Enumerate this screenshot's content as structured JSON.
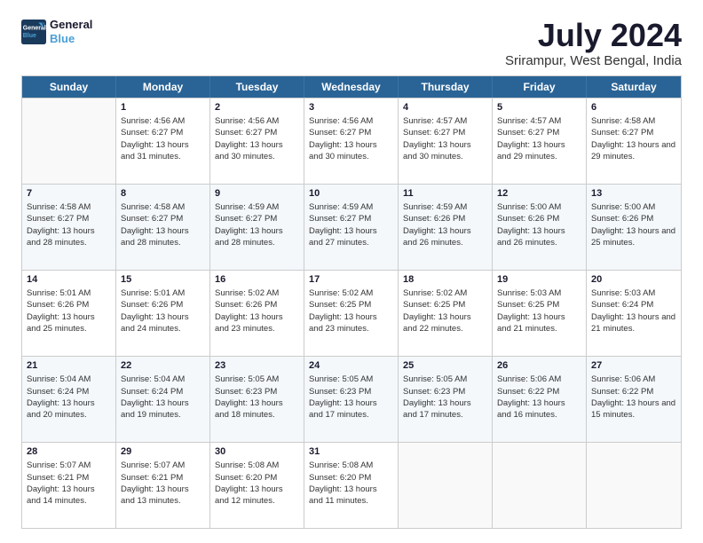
{
  "logo": {
    "line1": "General",
    "line2": "Blue"
  },
  "title": "July 2024",
  "subtitle": "Srirampur, West Bengal, India",
  "days": [
    "Sunday",
    "Monday",
    "Tuesday",
    "Wednesday",
    "Thursday",
    "Friday",
    "Saturday"
  ],
  "weeks": [
    [
      {
        "day": "",
        "sunrise": "",
        "sunset": "",
        "daylight": ""
      },
      {
        "day": "1",
        "sunrise": "Sunrise: 4:56 AM",
        "sunset": "Sunset: 6:27 PM",
        "daylight": "Daylight: 13 hours and 31 minutes."
      },
      {
        "day": "2",
        "sunrise": "Sunrise: 4:56 AM",
        "sunset": "Sunset: 6:27 PM",
        "daylight": "Daylight: 13 hours and 30 minutes."
      },
      {
        "day": "3",
        "sunrise": "Sunrise: 4:56 AM",
        "sunset": "Sunset: 6:27 PM",
        "daylight": "Daylight: 13 hours and 30 minutes."
      },
      {
        "day": "4",
        "sunrise": "Sunrise: 4:57 AM",
        "sunset": "Sunset: 6:27 PM",
        "daylight": "Daylight: 13 hours and 30 minutes."
      },
      {
        "day": "5",
        "sunrise": "Sunrise: 4:57 AM",
        "sunset": "Sunset: 6:27 PM",
        "daylight": "Daylight: 13 hours and 29 minutes."
      },
      {
        "day": "6",
        "sunrise": "Sunrise: 4:58 AM",
        "sunset": "Sunset: 6:27 PM",
        "daylight": "Daylight: 13 hours and 29 minutes."
      }
    ],
    [
      {
        "day": "7",
        "sunrise": "Sunrise: 4:58 AM",
        "sunset": "Sunset: 6:27 PM",
        "daylight": "Daylight: 13 hours and 28 minutes."
      },
      {
        "day": "8",
        "sunrise": "Sunrise: 4:58 AM",
        "sunset": "Sunset: 6:27 PM",
        "daylight": "Daylight: 13 hours and 28 minutes."
      },
      {
        "day": "9",
        "sunrise": "Sunrise: 4:59 AM",
        "sunset": "Sunset: 6:27 PM",
        "daylight": "Daylight: 13 hours and 28 minutes."
      },
      {
        "day": "10",
        "sunrise": "Sunrise: 4:59 AM",
        "sunset": "Sunset: 6:27 PM",
        "daylight": "Daylight: 13 hours and 27 minutes."
      },
      {
        "day": "11",
        "sunrise": "Sunrise: 4:59 AM",
        "sunset": "Sunset: 6:26 PM",
        "daylight": "Daylight: 13 hours and 26 minutes."
      },
      {
        "day": "12",
        "sunrise": "Sunrise: 5:00 AM",
        "sunset": "Sunset: 6:26 PM",
        "daylight": "Daylight: 13 hours and 26 minutes."
      },
      {
        "day": "13",
        "sunrise": "Sunrise: 5:00 AM",
        "sunset": "Sunset: 6:26 PM",
        "daylight": "Daylight: 13 hours and 25 minutes."
      }
    ],
    [
      {
        "day": "14",
        "sunrise": "Sunrise: 5:01 AM",
        "sunset": "Sunset: 6:26 PM",
        "daylight": "Daylight: 13 hours and 25 minutes."
      },
      {
        "day": "15",
        "sunrise": "Sunrise: 5:01 AM",
        "sunset": "Sunset: 6:26 PM",
        "daylight": "Daylight: 13 hours and 24 minutes."
      },
      {
        "day": "16",
        "sunrise": "Sunrise: 5:02 AM",
        "sunset": "Sunset: 6:26 PM",
        "daylight": "Daylight: 13 hours and 23 minutes."
      },
      {
        "day": "17",
        "sunrise": "Sunrise: 5:02 AM",
        "sunset": "Sunset: 6:25 PM",
        "daylight": "Daylight: 13 hours and 23 minutes."
      },
      {
        "day": "18",
        "sunrise": "Sunrise: 5:02 AM",
        "sunset": "Sunset: 6:25 PM",
        "daylight": "Daylight: 13 hours and 22 minutes."
      },
      {
        "day": "19",
        "sunrise": "Sunrise: 5:03 AM",
        "sunset": "Sunset: 6:25 PM",
        "daylight": "Daylight: 13 hours and 21 minutes."
      },
      {
        "day": "20",
        "sunrise": "Sunrise: 5:03 AM",
        "sunset": "Sunset: 6:24 PM",
        "daylight": "Daylight: 13 hours and 21 minutes."
      }
    ],
    [
      {
        "day": "21",
        "sunrise": "Sunrise: 5:04 AM",
        "sunset": "Sunset: 6:24 PM",
        "daylight": "Daylight: 13 hours and 20 minutes."
      },
      {
        "day": "22",
        "sunrise": "Sunrise: 5:04 AM",
        "sunset": "Sunset: 6:24 PM",
        "daylight": "Daylight: 13 hours and 19 minutes."
      },
      {
        "day": "23",
        "sunrise": "Sunrise: 5:05 AM",
        "sunset": "Sunset: 6:23 PM",
        "daylight": "Daylight: 13 hours and 18 minutes."
      },
      {
        "day": "24",
        "sunrise": "Sunrise: 5:05 AM",
        "sunset": "Sunset: 6:23 PM",
        "daylight": "Daylight: 13 hours and 17 minutes."
      },
      {
        "day": "25",
        "sunrise": "Sunrise: 5:05 AM",
        "sunset": "Sunset: 6:23 PM",
        "daylight": "Daylight: 13 hours and 17 minutes."
      },
      {
        "day": "26",
        "sunrise": "Sunrise: 5:06 AM",
        "sunset": "Sunset: 6:22 PM",
        "daylight": "Daylight: 13 hours and 16 minutes."
      },
      {
        "day": "27",
        "sunrise": "Sunrise: 5:06 AM",
        "sunset": "Sunset: 6:22 PM",
        "daylight": "Daylight: 13 hours and 15 minutes."
      }
    ],
    [
      {
        "day": "28",
        "sunrise": "Sunrise: 5:07 AM",
        "sunset": "Sunset: 6:21 PM",
        "daylight": "Daylight: 13 hours and 14 minutes."
      },
      {
        "day": "29",
        "sunrise": "Sunrise: 5:07 AM",
        "sunset": "Sunset: 6:21 PM",
        "daylight": "Daylight: 13 hours and 13 minutes."
      },
      {
        "day": "30",
        "sunrise": "Sunrise: 5:08 AM",
        "sunset": "Sunset: 6:20 PM",
        "daylight": "Daylight: 13 hours and 12 minutes."
      },
      {
        "day": "31",
        "sunrise": "Sunrise: 5:08 AM",
        "sunset": "Sunset: 6:20 PM",
        "daylight": "Daylight: 13 hours and 11 minutes."
      },
      {
        "day": "",
        "sunrise": "",
        "sunset": "",
        "daylight": ""
      },
      {
        "day": "",
        "sunrise": "",
        "sunset": "",
        "daylight": ""
      },
      {
        "day": "",
        "sunrise": "",
        "sunset": "",
        "daylight": ""
      }
    ]
  ]
}
